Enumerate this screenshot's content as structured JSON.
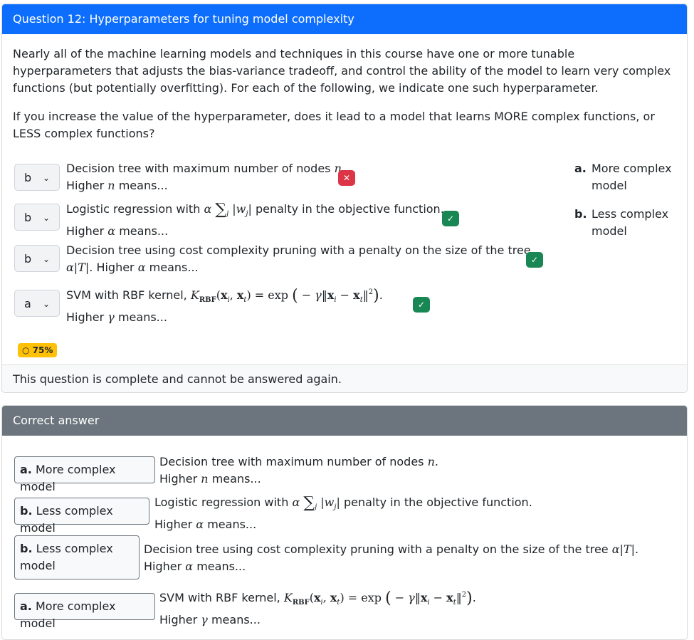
{
  "question": {
    "title": "Question 12: Hyperparameters for tuning model complexity",
    "intro": "Nearly all of the machine learning models and techniques in this course have one or more tunable hyperparameters that adjusts the bias-variance tradeoff, and control the ability of the model to learn very complex functions (but potentially overfitting). For each of the following, we indicate one such hyperparameter.",
    "prompt": "If you increase the value of the hyperparameter, does it lead to a model that learns MORE complex functions, or LESS complex functions?",
    "items": [
      {
        "answer": "b",
        "result": "incorrect"
      },
      {
        "answer": "b",
        "result": "correct"
      },
      {
        "answer": "b",
        "result": "correct"
      },
      {
        "answer": "a",
        "result": "correct"
      }
    ],
    "options": [
      {
        "key": "a.",
        "label": "More complex model"
      },
      {
        "key": "b.",
        "label": "Less complex model"
      }
    ],
    "score": "75%",
    "status": "This question is complete and cannot be answered again."
  },
  "text": {
    "tree_nodes": "Decision tree with maximum number of nodes",
    "higher": "Higher",
    "means": "means...",
    "logreg": "Logistic regression with",
    "penalty_obj": "penalty in the objective function.",
    "cost_pruning": "Decision tree using cost complexity pruning with a penalty on the size of the tree",
    "svm": "SVM with RBF kernel,",
    "dot_higher": ". Higher"
  },
  "correct_answer": {
    "header": "Correct answer",
    "answers": [
      {
        "key": "a.",
        "label": "More complex model"
      },
      {
        "key": "b.",
        "label": "Less complex model"
      },
      {
        "key": "b.",
        "label": "Less complex model"
      },
      {
        "key": "a.",
        "label": "More complex model"
      }
    ]
  },
  "colors": {
    "primary": "#0d6efd",
    "secondary": "#6c757d",
    "success": "#198754",
    "danger": "#dc3545",
    "warning": "#ffc107"
  }
}
